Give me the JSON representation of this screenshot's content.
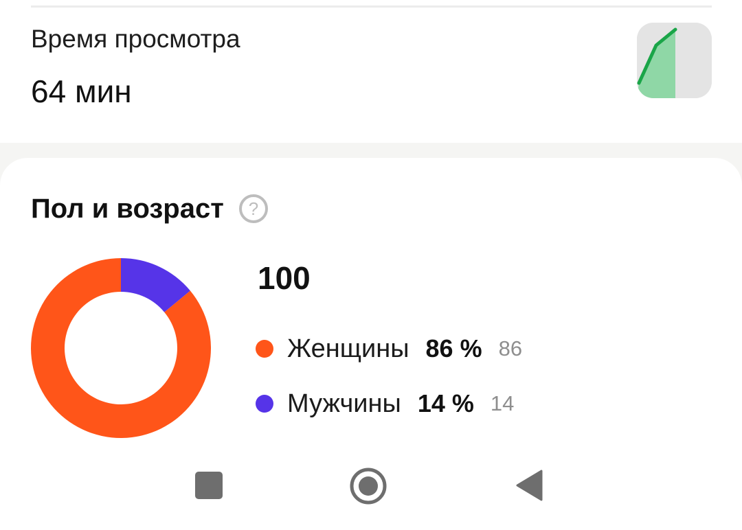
{
  "watch_time": {
    "label": "Время просмотра",
    "value": "64 мин",
    "sparkline_color": "#1aa548",
    "sparkline_fill": "#8fd7a6"
  },
  "gender_age": {
    "title": "Пол и возраст",
    "help_icon": "question-circle-icon",
    "total": "100",
    "items": [
      {
        "label": "Женщины",
        "percent": "86 %",
        "count": "86",
        "share": 86,
        "color": "#ff5519"
      },
      {
        "label": "Мужчины",
        "percent": "14 %",
        "count": "14",
        "share": 14,
        "color": "#5634e8"
      }
    ]
  },
  "nav_bar": {
    "recents_icon": "square-icon",
    "home_icon": "home-circle-icon",
    "back_icon": "back-triangle-icon"
  }
}
